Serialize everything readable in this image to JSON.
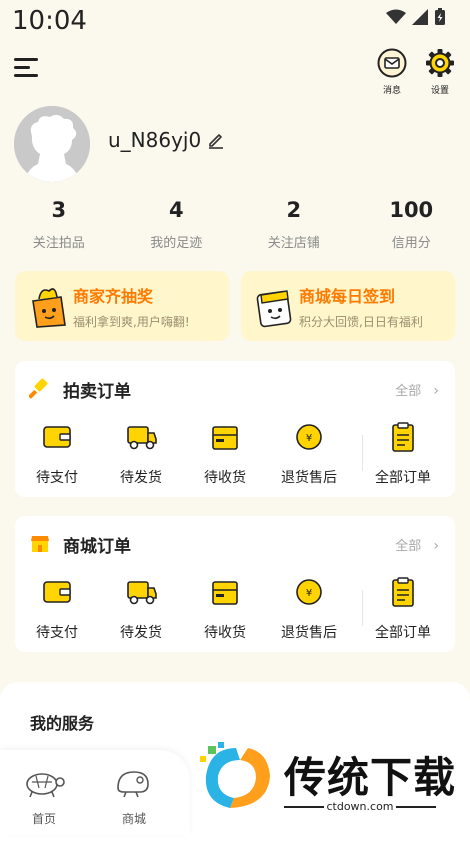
{
  "status": {
    "time": "10:04"
  },
  "header": {
    "messages_label": "消息",
    "settings_label": "设置"
  },
  "profile": {
    "username": "u_N86yj0"
  },
  "stats": [
    {
      "value": "3",
      "label": "关注拍品"
    },
    {
      "value": "4",
      "label": "我的足迹"
    },
    {
      "value": "2",
      "label": "关注店铺"
    },
    {
      "value": "100",
      "label": "信用分"
    }
  ],
  "promos": [
    {
      "title": "商家齐抽奖",
      "subtitle": "福利拿到爽,用户嗨翻!"
    },
    {
      "title": "商城每日签到",
      "subtitle": "积分大回馈,日日有福利"
    }
  ],
  "auction_orders": {
    "title": "拍卖订单",
    "all_label": "全部",
    "items": [
      "待支付",
      "待发货",
      "待收货",
      "退货售后",
      "全部订单"
    ]
  },
  "mall_orders": {
    "title": "商城订单",
    "all_label": "全部",
    "items": [
      "待支付",
      "待发货",
      "待收货",
      "退货售后",
      "全部订单"
    ]
  },
  "services": {
    "title": "我的服务"
  },
  "tabbar": {
    "tabs": [
      "首页",
      "商城"
    ]
  },
  "watermark": {
    "title": "传统下载",
    "url": "ctdown.com"
  },
  "colors": {
    "accent": "#FFD400",
    "promo_text": "#FF7A00",
    "background": "#FBF9EE"
  }
}
